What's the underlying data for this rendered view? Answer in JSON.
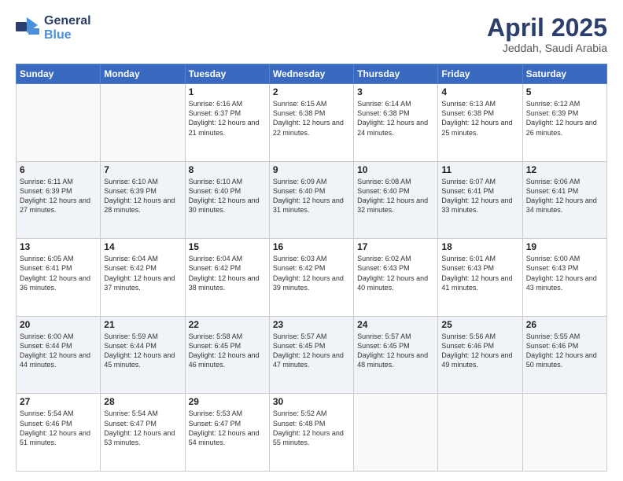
{
  "header": {
    "logo_line1": "General",
    "logo_line2": "Blue",
    "month": "April 2025",
    "location": "Jeddah, Saudi Arabia"
  },
  "days_of_week": [
    "Sunday",
    "Monday",
    "Tuesday",
    "Wednesday",
    "Thursday",
    "Friday",
    "Saturday"
  ],
  "weeks": [
    [
      {
        "day": "",
        "text": ""
      },
      {
        "day": "",
        "text": ""
      },
      {
        "day": "1",
        "text": "Sunrise: 6:16 AM\nSunset: 6:37 PM\nDaylight: 12 hours and 21 minutes."
      },
      {
        "day": "2",
        "text": "Sunrise: 6:15 AM\nSunset: 6:38 PM\nDaylight: 12 hours and 22 minutes."
      },
      {
        "day": "3",
        "text": "Sunrise: 6:14 AM\nSunset: 6:38 PM\nDaylight: 12 hours and 24 minutes."
      },
      {
        "day": "4",
        "text": "Sunrise: 6:13 AM\nSunset: 6:38 PM\nDaylight: 12 hours and 25 minutes."
      },
      {
        "day": "5",
        "text": "Sunrise: 6:12 AM\nSunset: 6:39 PM\nDaylight: 12 hours and 26 minutes."
      }
    ],
    [
      {
        "day": "6",
        "text": "Sunrise: 6:11 AM\nSunset: 6:39 PM\nDaylight: 12 hours and 27 minutes."
      },
      {
        "day": "7",
        "text": "Sunrise: 6:10 AM\nSunset: 6:39 PM\nDaylight: 12 hours and 28 minutes."
      },
      {
        "day": "8",
        "text": "Sunrise: 6:10 AM\nSunset: 6:40 PM\nDaylight: 12 hours and 30 minutes."
      },
      {
        "day": "9",
        "text": "Sunrise: 6:09 AM\nSunset: 6:40 PM\nDaylight: 12 hours and 31 minutes."
      },
      {
        "day": "10",
        "text": "Sunrise: 6:08 AM\nSunset: 6:40 PM\nDaylight: 12 hours and 32 minutes."
      },
      {
        "day": "11",
        "text": "Sunrise: 6:07 AM\nSunset: 6:41 PM\nDaylight: 12 hours and 33 minutes."
      },
      {
        "day": "12",
        "text": "Sunrise: 6:06 AM\nSunset: 6:41 PM\nDaylight: 12 hours and 34 minutes."
      }
    ],
    [
      {
        "day": "13",
        "text": "Sunrise: 6:05 AM\nSunset: 6:41 PM\nDaylight: 12 hours and 36 minutes."
      },
      {
        "day": "14",
        "text": "Sunrise: 6:04 AM\nSunset: 6:42 PM\nDaylight: 12 hours and 37 minutes."
      },
      {
        "day": "15",
        "text": "Sunrise: 6:04 AM\nSunset: 6:42 PM\nDaylight: 12 hours and 38 minutes."
      },
      {
        "day": "16",
        "text": "Sunrise: 6:03 AM\nSunset: 6:42 PM\nDaylight: 12 hours and 39 minutes."
      },
      {
        "day": "17",
        "text": "Sunrise: 6:02 AM\nSunset: 6:43 PM\nDaylight: 12 hours and 40 minutes."
      },
      {
        "day": "18",
        "text": "Sunrise: 6:01 AM\nSunset: 6:43 PM\nDaylight: 12 hours and 41 minutes."
      },
      {
        "day": "19",
        "text": "Sunrise: 6:00 AM\nSunset: 6:43 PM\nDaylight: 12 hours and 43 minutes."
      }
    ],
    [
      {
        "day": "20",
        "text": "Sunrise: 6:00 AM\nSunset: 6:44 PM\nDaylight: 12 hours and 44 minutes."
      },
      {
        "day": "21",
        "text": "Sunrise: 5:59 AM\nSunset: 6:44 PM\nDaylight: 12 hours and 45 minutes."
      },
      {
        "day": "22",
        "text": "Sunrise: 5:58 AM\nSunset: 6:45 PM\nDaylight: 12 hours and 46 minutes."
      },
      {
        "day": "23",
        "text": "Sunrise: 5:57 AM\nSunset: 6:45 PM\nDaylight: 12 hours and 47 minutes."
      },
      {
        "day": "24",
        "text": "Sunrise: 5:57 AM\nSunset: 6:45 PM\nDaylight: 12 hours and 48 minutes."
      },
      {
        "day": "25",
        "text": "Sunrise: 5:56 AM\nSunset: 6:46 PM\nDaylight: 12 hours and 49 minutes."
      },
      {
        "day": "26",
        "text": "Sunrise: 5:55 AM\nSunset: 6:46 PM\nDaylight: 12 hours and 50 minutes."
      }
    ],
    [
      {
        "day": "27",
        "text": "Sunrise: 5:54 AM\nSunset: 6:46 PM\nDaylight: 12 hours and 51 minutes."
      },
      {
        "day": "28",
        "text": "Sunrise: 5:54 AM\nSunset: 6:47 PM\nDaylight: 12 hours and 53 minutes."
      },
      {
        "day": "29",
        "text": "Sunrise: 5:53 AM\nSunset: 6:47 PM\nDaylight: 12 hours and 54 minutes."
      },
      {
        "day": "30",
        "text": "Sunrise: 5:52 AM\nSunset: 6:48 PM\nDaylight: 12 hours and 55 minutes."
      },
      {
        "day": "",
        "text": ""
      },
      {
        "day": "",
        "text": ""
      },
      {
        "day": "",
        "text": ""
      }
    ]
  ]
}
